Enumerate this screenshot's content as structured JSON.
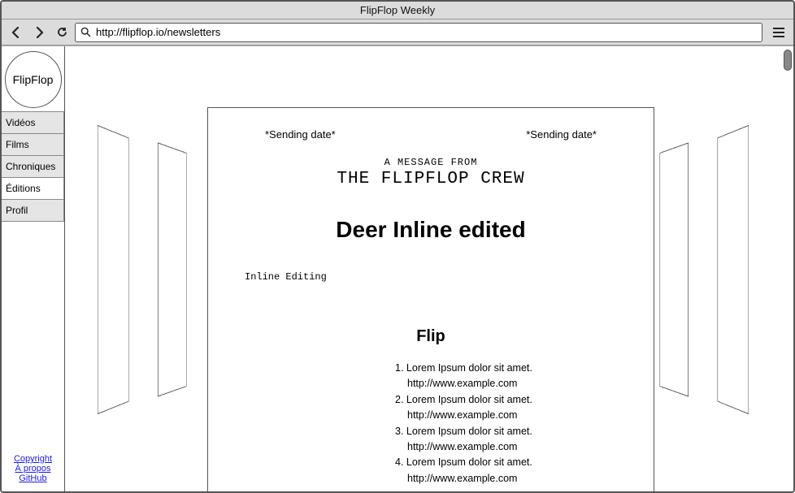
{
  "window": {
    "title": "FlipFlop Weekly"
  },
  "url": "http://flipflop.io/newsletters",
  "logo": "FlipFlop",
  "nav": {
    "items": [
      {
        "label": "Vidéos",
        "light": false
      },
      {
        "label": "Films",
        "light": false
      },
      {
        "label": "Chroniques",
        "light": false
      },
      {
        "label": "Éditions",
        "light": true
      },
      {
        "label": "Profil",
        "light": false
      }
    ]
  },
  "footer": {
    "links": [
      "Copyright",
      "À propos",
      "GitHub"
    ]
  },
  "card": {
    "send_left": "*Sending date*",
    "send_right": "*Sending date*",
    "msg_from": "A MESSAGE FROM",
    "crew": "THE FLIPFLOP CREW",
    "title": "Deer Inline edited",
    "inline_label": "Inline Editing",
    "section": "Flip",
    "items": [
      {
        "n": "1.",
        "text": "Lorem Ipsum dolor sit amet.",
        "url": "http://www.example.com"
      },
      {
        "n": "2.",
        "text": "Lorem Ipsum dolor sit amet.",
        "url": "http://www.example.com"
      },
      {
        "n": "3.",
        "text": "Lorem Ipsum dolor sit amet.",
        "url": "http://www.example.com"
      },
      {
        "n": "4.",
        "text": "Lorem Ipsum dolor sit amet.",
        "url": "http://www.example.com"
      }
    ]
  }
}
